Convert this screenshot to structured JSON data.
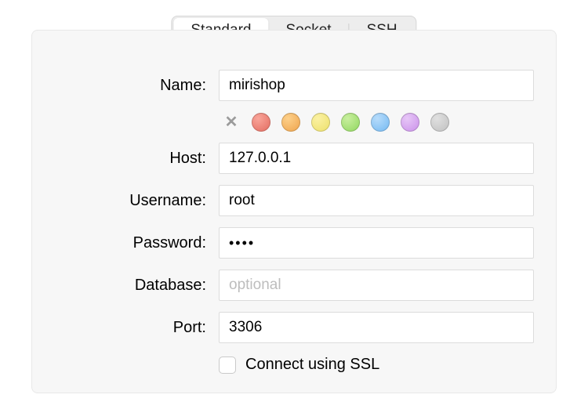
{
  "tabs": {
    "standard": "Standard",
    "socket": "Socket",
    "ssh": "SSH",
    "active": "standard"
  },
  "labels": {
    "name": "Name:",
    "host": "Host:",
    "username": "Username:",
    "password": "Password:",
    "database": "Database:",
    "port": "Port:"
  },
  "fields": {
    "name": "mirishop",
    "host": "127.0.0.1",
    "username": "root",
    "password": "••••",
    "database": "",
    "database_placeholder": "optional",
    "port": "3306"
  },
  "colors": {
    "red": "#e26a5e",
    "orange": "#eea24a",
    "yellow": "#ece069",
    "green": "#8ed65d",
    "blue": "#71b7f1",
    "purple": "#c98ee9",
    "gray": "#bfbfbf"
  },
  "ssl": {
    "label": "Connect using SSL",
    "checked": false
  }
}
